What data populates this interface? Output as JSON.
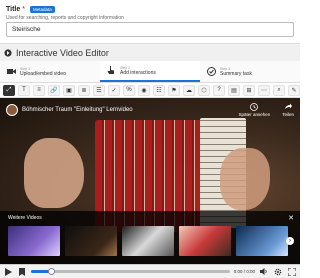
{
  "title_field": {
    "label": "Title",
    "required_marker": "*",
    "badge": "Metadata",
    "helper": "Used for searching, reports and copyright information",
    "value": "Steirische"
  },
  "editor": {
    "title": "Interactive Video Editor"
  },
  "steps": [
    {
      "num": "Step 1",
      "label": "Upload/embed video"
    },
    {
      "num": "Step 2",
      "label": "Add interactions"
    },
    {
      "num": "Step 3",
      "label": "Summary task"
    }
  ],
  "toolbar": {
    "items": [
      "T",
      "≡",
      "🔗",
      "▣",
      "≣",
      "☰",
      "✓",
      "%",
      "◉",
      "☷",
      "⚑",
      "☁",
      "⬡",
      "?",
      "▤",
      "⊞",
      "⋯",
      "⌕",
      "✎"
    ]
  },
  "video": {
    "title": "Böhmischer Traum \"Einleitung\" Lernvideo",
    "watch_later": "Später ansehen",
    "share": "Teilen",
    "more_videos": "Weitere Videos",
    "close": "✕",
    "next": "›"
  },
  "controls": {
    "time": "0:00 / 0:00",
    "progress": 0.1
  },
  "colors": {
    "accent": "#1a73d9",
    "required": "#cc0000"
  }
}
